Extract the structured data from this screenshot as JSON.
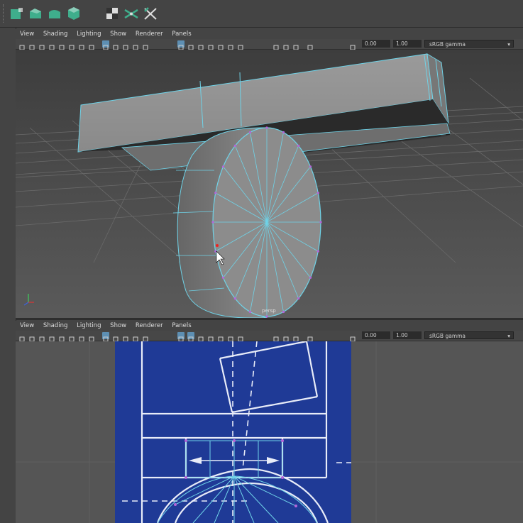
{
  "shelf": {
    "icons": [
      "poly-cube-icon",
      "poly-extrude-icon",
      "poly-bevel-icon",
      "poly-bridge-icon",
      "poly-append-icon",
      "poly-uv-checker-icon",
      "poly-multicut-icon",
      "poly-target-weld-icon"
    ]
  },
  "top_panel": {
    "menu": [
      "View",
      "Shading",
      "Lighting",
      "Show",
      "Renderer",
      "Panels"
    ],
    "exposure": "0.00",
    "gamma_value": "1.00",
    "color_space": "sRGB gamma",
    "camera_label": "persp"
  },
  "bottom_panel": {
    "menu": [
      "View",
      "Shading",
      "Lighting",
      "Show",
      "Renderer",
      "Panels"
    ],
    "exposure": "0.00",
    "gamma_value": "1.00",
    "color_space": "sRGB gamma"
  },
  "colors": {
    "shelf_icon": "#3fae8c",
    "wire": "#6fd3e8",
    "mesh": "#8e8e8e",
    "blueprint": "#1f3a96",
    "selection": "#5d8fb3"
  }
}
